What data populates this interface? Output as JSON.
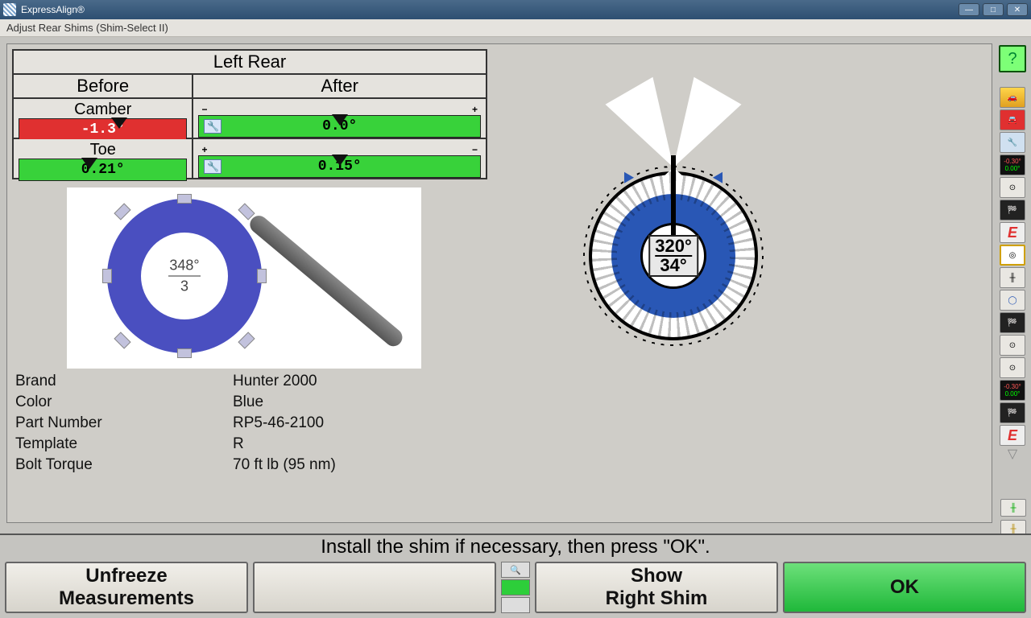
{
  "window": {
    "title": "ExpressAlign®",
    "subtitle": "Adjust Rear Shims   (Shim-Select II)"
  },
  "panel": {
    "title": "Left Rear",
    "before_label": "Before",
    "after_label": "After",
    "camber_label": "Camber",
    "toe_label": "Toe",
    "camber_before": "-1.3°",
    "camber_after": "0.0°",
    "toe_before": "0.21°",
    "toe_after": "0.15°"
  },
  "shim_catalog": {
    "angle": "348°",
    "index": "3"
  },
  "props": {
    "brand_k": "Brand",
    "brand_v": "Hunter 2000",
    "color_k": "Color",
    "color_v": "Blue",
    "part_k": "Part Number",
    "part_v": "RP5-46-2100",
    "tmpl_k": "Template",
    "tmpl_v": "R",
    "torque_k": "Bolt Torque",
    "torque_v": "70 ft lb (95 nm)"
  },
  "dial": {
    "angle": "320°",
    "value": "34°"
  },
  "instruction": "Install the shim if necessary, then press \"OK\".",
  "buttons": {
    "unfreeze": "Unfreeze\nMeasurements",
    "show_right": "Show\nRight Shim",
    "ok": "OK"
  },
  "toolbar_readout": {
    "line1": "-0.30°",
    "line2": "0.00°"
  }
}
